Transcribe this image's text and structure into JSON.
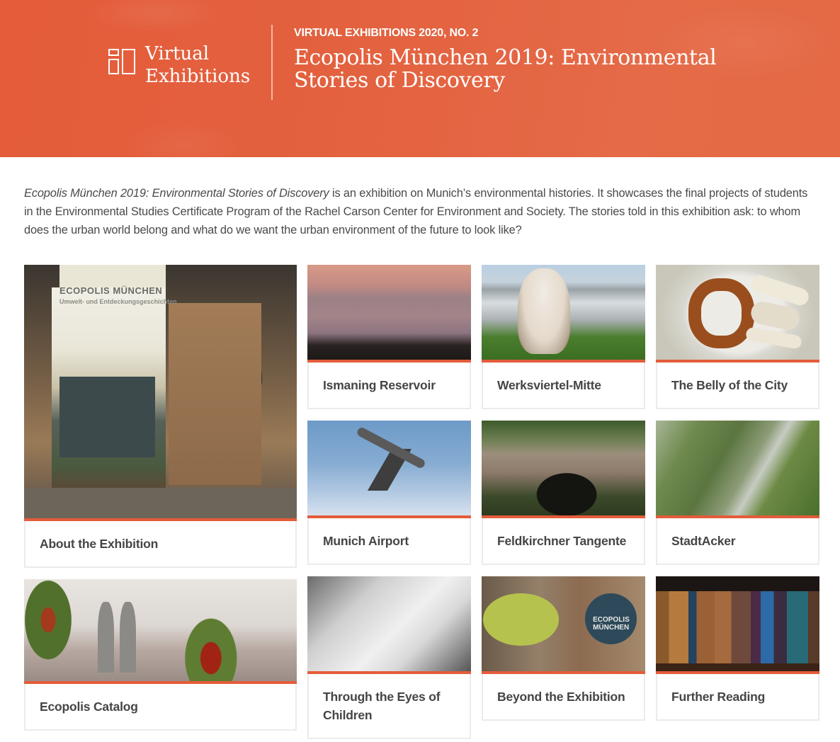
{
  "header": {
    "logo_line1": "Virtual",
    "logo_line2": "Exhibitions",
    "kicker": "VIRTUAL EXHIBITIONS 2020, NO. 2",
    "title": "Ecopolis München 2019: Environmental Stories of Discovery",
    "logo_icon": "gallery-layout-icon"
  },
  "intro": {
    "italic_title": "Ecopolis München 2019: Environmental Stories of Discovery",
    "text": " is an exhibition on Munich’s environmental histories. It showcases the final projects of students in the Environmental Studies Certificate Program of the Rachel Carson Center for Environment and Society. The stories told in this exhibition ask: to whom does the urban world belong and what do we want the urban environment of the future to look like?"
  },
  "colors": {
    "accent": "#e45c3a",
    "text": "#454545",
    "card_border": "#ebebeb"
  },
  "cards": [
    {
      "label": "About the Exhibition",
      "image": "exhibition display with Ecopolis München panel",
      "image_text_title": "ECOPOLIS MÜNCHEN",
      "image_text_sub": "Umwelt- und Entdeckungsgeschichten"
    },
    {
      "label": "Ismaning Reservoir",
      "image": "reservoir at sunset"
    },
    {
      "label": "Werksviertel-Mitte",
      "image": "sheep grazing on rooftop"
    },
    {
      "label": "The Belly of the City",
      "image": "pretzel and white sausages on plate"
    },
    {
      "label": "Munich Airport",
      "image": "airplane taking off"
    },
    {
      "label": "Feldkirchner Tangente",
      "image": "overgrown brick tunnel"
    },
    {
      "label": "StadtAcker",
      "image": "aerial view of urban garden"
    },
    {
      "label": "Ecopolis Catalog",
      "image": "sunflowers with Frauenkirche towers"
    },
    {
      "label": "Through the Eyes of Children",
      "image": "children drawing"
    },
    {
      "label": "Beyond the Exhibition",
      "image": "speech bubble signs",
      "image_text": "ECOPOLIS MÜNCHEN"
    },
    {
      "label": "Further Reading",
      "image": "old books on shelf"
    }
  ]
}
